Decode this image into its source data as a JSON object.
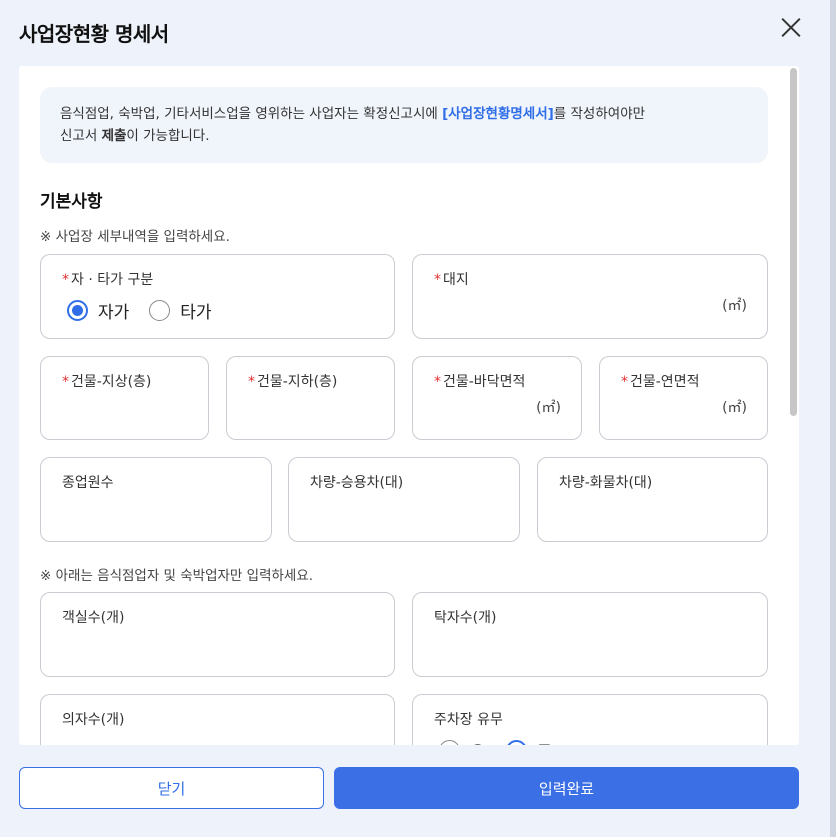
{
  "dialog": {
    "title": "사업장현황 명세서",
    "close_label": "닫기",
    "submit_label": "입력완료"
  },
  "notice": {
    "text1": "음식점업, 숙박업, 기타서비스업을 영위하는 사업자는 확정신고시에 ",
    "highlight": "[사업장현황명세서]",
    "text2": "를  작성하여야만",
    "text3": "신고서 ",
    "bold": "제출",
    "text4": "이 가능합니다."
  },
  "basic": {
    "title": "기본사항",
    "hint": "※ 사업장 세부내역을 입력하세요.",
    "ownership": {
      "label": "자 · 타가 구분",
      "required": "*",
      "options": [
        "자가",
        "타가"
      ],
      "selected": "자가"
    },
    "land": {
      "label": "대지",
      "required": "*",
      "unit": "(㎡)",
      "value": ""
    },
    "floors_above": {
      "label": "건물-지상(층)",
      "required": "*",
      "value": ""
    },
    "floors_below": {
      "label": "건물-지하(층)",
      "required": "*",
      "value": ""
    },
    "floor_area": {
      "label": "건물-바닥면적",
      "required": "*",
      "unit": "(㎡)",
      "value": ""
    },
    "total_area": {
      "label": "건물-연면적",
      "required": "*",
      "unit": "(㎡)",
      "value": ""
    },
    "employees": {
      "label": "종업원수",
      "value": ""
    },
    "passenger_cars": {
      "label": "차량-승용차(대)",
      "value": ""
    },
    "trucks": {
      "label": "차량-화물차(대)",
      "value": ""
    }
  },
  "restaurant": {
    "hint": "※ 아래는 음식점업자 및 숙박업자만 입력하세요.",
    "rooms": {
      "label": "객실수(개)",
      "value": ""
    },
    "tables": {
      "label": "탁자수(개)",
      "value": ""
    },
    "chairs": {
      "label": "의자수(개)",
      "value": ""
    },
    "parking": {
      "label": "주차장 유무",
      "options": [
        "유",
        "무"
      ],
      "selected": "무"
    }
  },
  "colors": {
    "accent": "#2f6ee8",
    "required": "#e03030",
    "panel_bg": "#ffffff",
    "modal_bg": "#eef2fa"
  }
}
